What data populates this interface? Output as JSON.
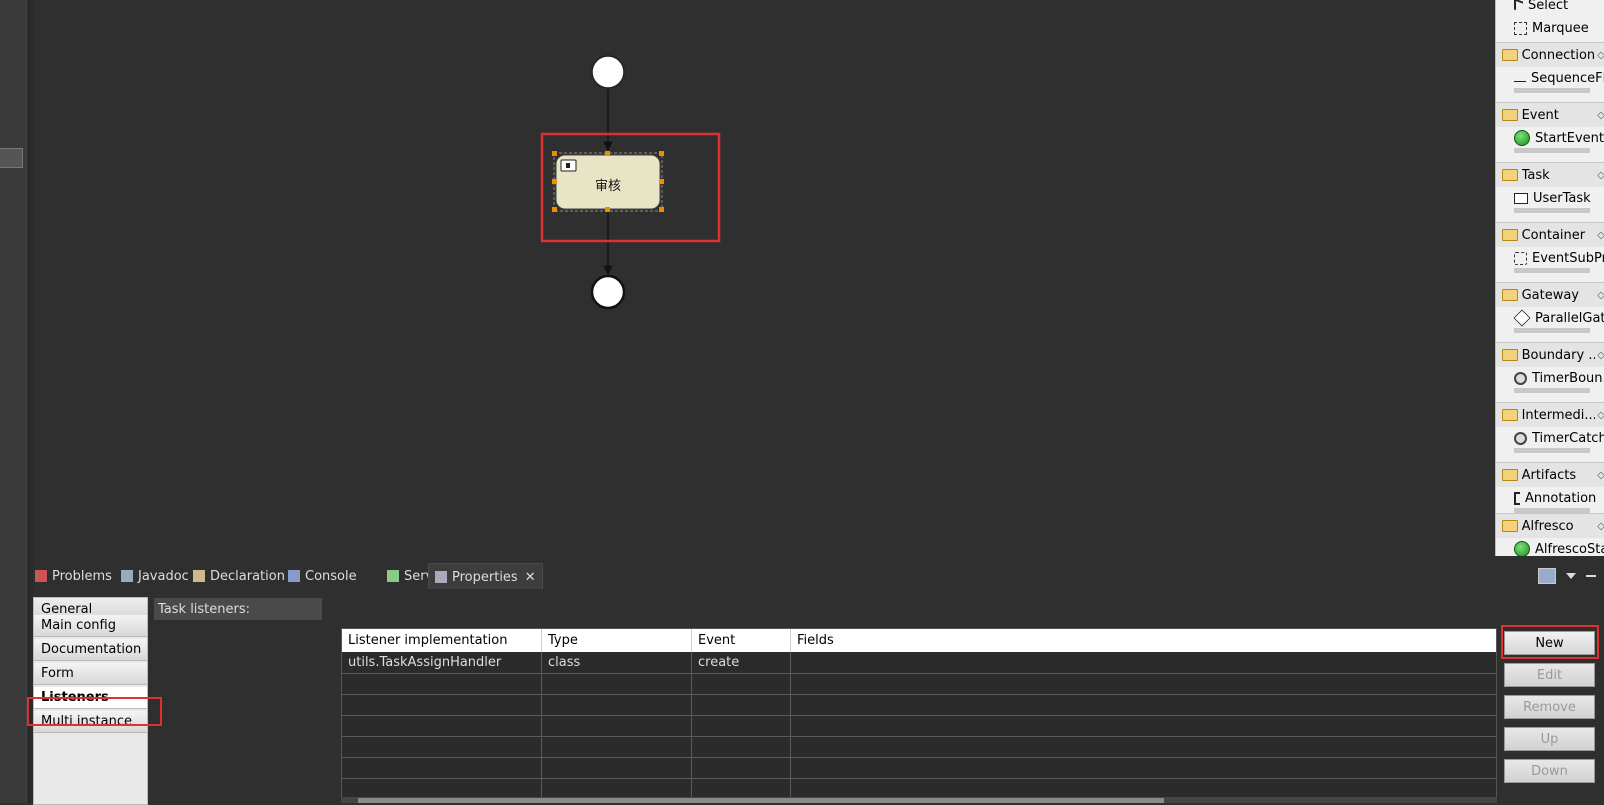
{
  "diagram": {
    "task_label": "审核"
  },
  "palette": {
    "items": [
      {
        "kind": "item",
        "label": "Select",
        "icon": "cursor-icon"
      },
      {
        "kind": "item",
        "label": "Marquee",
        "icon": "marquee-icon"
      },
      {
        "kind": "head",
        "label": "Connection"
      },
      {
        "kind": "item",
        "label": "SequenceFl...",
        "icon": "arrow-icon"
      },
      {
        "kind": "head",
        "label": "Event"
      },
      {
        "kind": "item",
        "label": "StartEvent",
        "icon": "green-circle-icon"
      },
      {
        "kind": "head",
        "label": "Task"
      },
      {
        "kind": "item",
        "label": "UserTask",
        "icon": "user-task-icon"
      },
      {
        "kind": "head",
        "label": "Container"
      },
      {
        "kind": "item",
        "label": "EventSubPr...",
        "icon": "dashed-box-icon"
      },
      {
        "kind": "head",
        "label": "Gateway"
      },
      {
        "kind": "item",
        "label": "ParallelGat...",
        "icon": "diamond-plus-icon"
      },
      {
        "kind": "head",
        "label": "Boundary ..."
      },
      {
        "kind": "item",
        "label": "TimerBoun...",
        "icon": "timer-icon"
      },
      {
        "kind": "head",
        "label": "Intermedi..."
      },
      {
        "kind": "item",
        "label": "TimerCatchi...",
        "icon": "timer-icon"
      },
      {
        "kind": "head",
        "label": "Artifacts"
      },
      {
        "kind": "item",
        "label": "Annotation",
        "icon": "bracket-icon"
      },
      {
        "kind": "head",
        "label": "Alfresco"
      },
      {
        "kind": "item",
        "label": "AlfrescoSta...",
        "icon": "green-circle-icon"
      }
    ]
  },
  "tabs": [
    {
      "label": "Problems",
      "icon": "problems-icon",
      "active": false
    },
    {
      "label": "Javadoc",
      "icon": "javadoc-icon",
      "active": false
    },
    {
      "label": "Declaration",
      "icon": "declaration-icon",
      "active": false
    },
    {
      "label": "Console",
      "icon": "console-icon",
      "active": false
    },
    {
      "label": "Servers",
      "icon": "servers-icon",
      "active": false
    },
    {
      "label": "Properties",
      "icon": "properties-icon",
      "active": true
    }
  ],
  "nav": {
    "items": [
      "General",
      "Main config",
      "Documentation",
      "Form",
      "Listeners",
      "Multi instance"
    ],
    "active": "Listeners"
  },
  "section_label": "Task listeners:",
  "table": {
    "columns": [
      "Listener implementation",
      "Type",
      "Event",
      "Fields"
    ],
    "rows": [
      [
        "utils.TaskAssignHandler",
        "class",
        "create",
        ""
      ]
    ]
  },
  "buttons": {
    "new": "New",
    "edit": "Edit",
    "remove": "Remove",
    "up": "Up",
    "down": "Down"
  }
}
